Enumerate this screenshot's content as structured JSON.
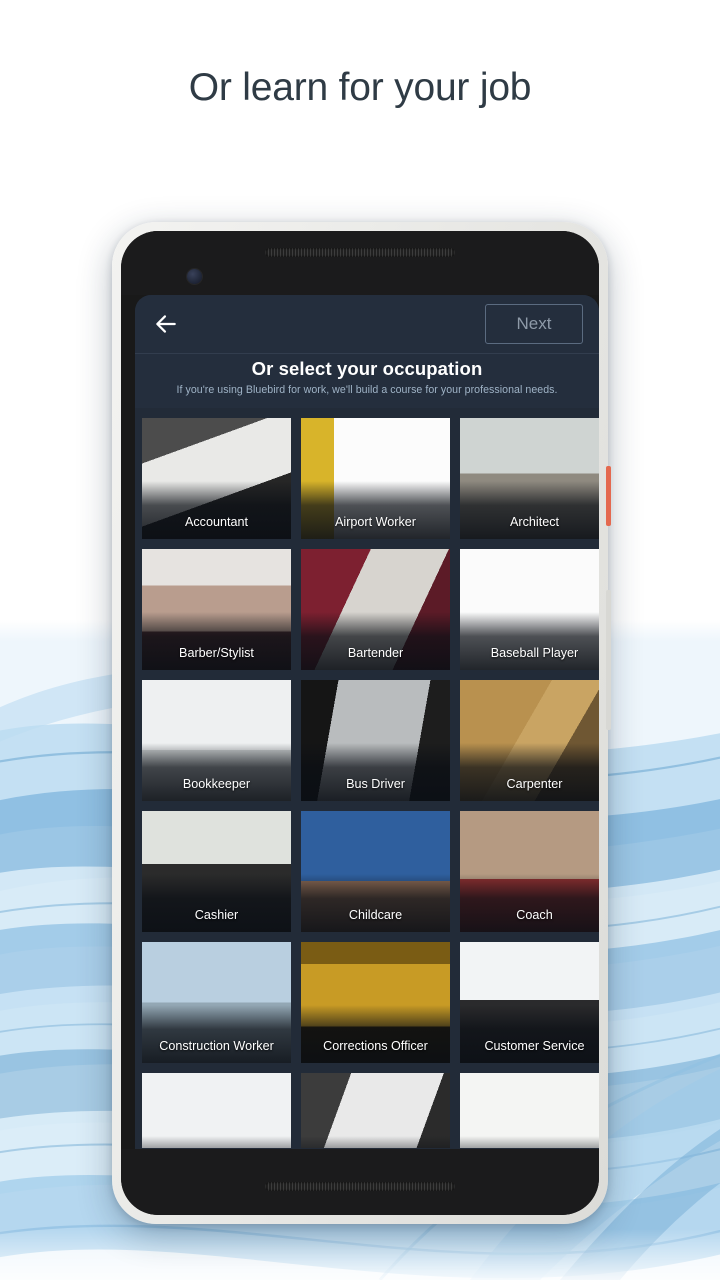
{
  "page": {
    "headline": "Or learn for your job"
  },
  "app": {
    "appbar": {
      "back_icon": "arrow-left-icon",
      "next_label": "Next"
    },
    "section": {
      "title": "Or select your occupation",
      "description": "If you're using Bluebird for work, we'll build a course for your professional needs."
    },
    "occupations": [
      {
        "label": "Accountant",
        "row": 1
      },
      {
        "label": "Airport Worker",
        "row": 1
      },
      {
        "label": "Architect",
        "row": 1
      },
      {
        "label": "Barber/Stylist",
        "row": 2
      },
      {
        "label": "Bartender",
        "row": 2
      },
      {
        "label": "Baseball Player",
        "row": 2
      },
      {
        "label": "Bookkeeper",
        "row": 3
      },
      {
        "label": "Bus Driver",
        "row": 3
      },
      {
        "label": "Carpenter",
        "row": 3
      },
      {
        "label": "Cashier",
        "row": 4
      },
      {
        "label": "Childcare",
        "row": 4
      },
      {
        "label": "Coach",
        "row": 4
      },
      {
        "label": "Construction Worker",
        "row": 5
      },
      {
        "label": "Corrections Officer",
        "row": 5
      },
      {
        "label": "Customer Service",
        "row": 5
      },
      {
        "label": "",
        "row": 6
      },
      {
        "label": "",
        "row": 6
      },
      {
        "label": "",
        "row": 6
      }
    ],
    "colors": {
      "screen_background": "#222b38",
      "appbar_background": "#242e3d",
      "label_text": "#ffffff",
      "description_text": "#9fb3c6",
      "next_border": "#5b6b80",
      "next_text": "#8e9aa8"
    }
  },
  "device": {
    "power_button_color": "#e4694f",
    "volume_button_color": "#d8d8d4"
  },
  "background": {
    "wave_color_light": "#cfe6f6",
    "wave_color_mid": "#9ecbe8",
    "wave_color_dark": "#5e9dc8"
  }
}
